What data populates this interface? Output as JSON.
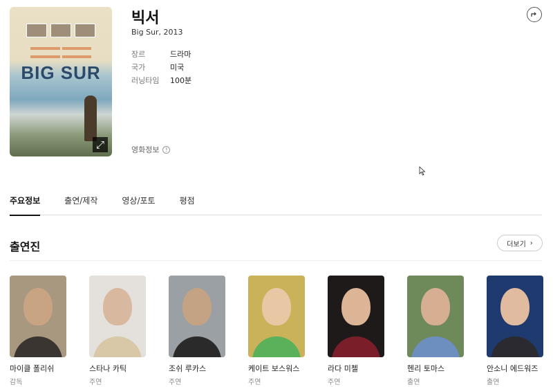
{
  "movie": {
    "title": "빅서",
    "subtitle": "Big Sur, 2013",
    "poster": {
      "title_text": "BIG SUR",
      "expand_icon": "expand-icon"
    },
    "meta": [
      {
        "label": "장르",
        "value": "드라마"
      },
      {
        "label": "국가",
        "value": "미국"
      },
      {
        "label": "러닝타임",
        "value": "100분"
      }
    ],
    "info_link": "영화정보",
    "info_icon": "info-icon",
    "share_icon": "share-icon"
  },
  "tabs": [
    {
      "label": "주요정보",
      "active": true
    },
    {
      "label": "출연/제작",
      "active": false
    },
    {
      "label": "영상/포토",
      "active": false
    },
    {
      "label": "평점",
      "active": false
    }
  ],
  "cast_section": {
    "title": "출연진",
    "more_label": "더보기",
    "members": [
      {
        "name": "마이클 폴리쉬",
        "role": "감독"
      },
      {
        "name": "스타나 카틱",
        "role": "주연"
      },
      {
        "name": "조쉬 루카스",
        "role": "주연"
      },
      {
        "name": "케이트 보스워스",
        "role": "주연"
      },
      {
        "name": "라다 미첼",
        "role": "주연"
      },
      {
        "name": "헨리 토마스",
        "role": "출연"
      },
      {
        "name": "안소니 에드워즈",
        "role": "출연"
      }
    ]
  },
  "colors": {
    "accent": "#111111",
    "muted_text": "#888888",
    "divider": "#dddddd"
  }
}
